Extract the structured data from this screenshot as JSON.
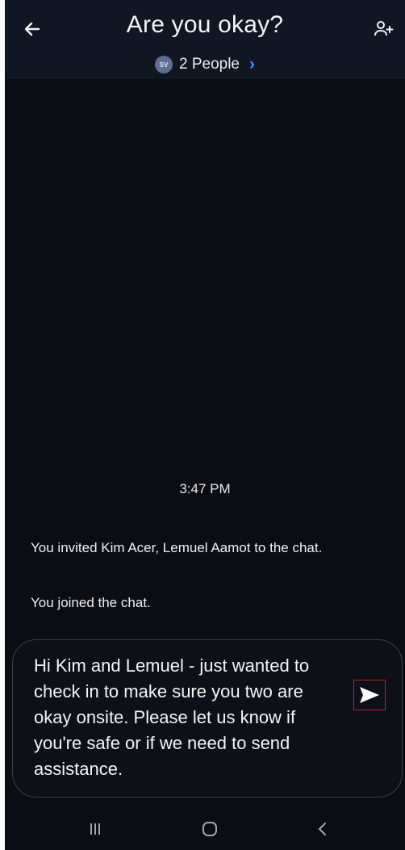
{
  "header": {
    "title": "Are you okay?",
    "avatar_initials": "SV",
    "people_label": "2 People",
    "back_icon": "back-arrow-icon",
    "add_icon": "add-person-icon"
  },
  "conversation": {
    "timestamp": "3:47 PM",
    "system_messages": [
      "You invited Kim Acer, Lemuel Aamot to the chat.",
      "You joined the chat."
    ]
  },
  "composer": {
    "text": "Hi Kim and Lemuel - just wanted to\ncheck in to make sure you two are\nokay onsite. Please let us know if\nyou're safe or if we need to send\nassistance.",
    "send_icon": "send-icon"
  },
  "navbar": {
    "recents_icon": "recents-icon",
    "home_icon": "home-icon",
    "back_icon": "nav-back-icon"
  },
  "colors": {
    "background": "#0b0d13",
    "header": "#111722",
    "accent": "#4c8cf7",
    "send_highlight": "#b3262b"
  }
}
